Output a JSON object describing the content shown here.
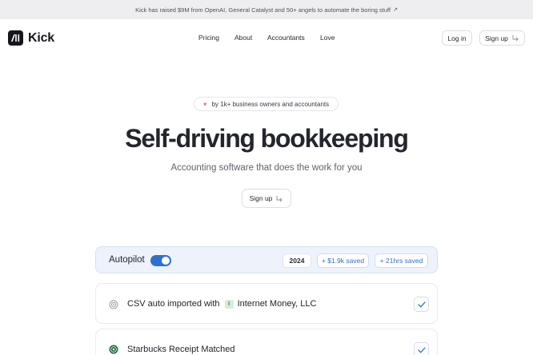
{
  "announcement": {
    "text": "Kick has raised $9M from OpenAI, General Catalyst and 50+ angels to automate the boring stuff",
    "arrow": "↗"
  },
  "brand": {
    "name": "Kick",
    "mark": "/ll"
  },
  "nav": {
    "links": [
      "Pricing",
      "About",
      "Accountants",
      "Love"
    ],
    "login": "Log in",
    "signup": "Sign up"
  },
  "hero": {
    "badge": "by 1k+ business owners and accountants",
    "title": "Self-driving bookkeeping",
    "subtitle": "Accounting software that does the work for you",
    "cta": "Sign up"
  },
  "autopilot": {
    "label": "Autopilot",
    "enabled": true,
    "year": "2024",
    "saved_money": "+ $1.9k saved",
    "saved_time": "+ 21hrs saved"
  },
  "feed": [
    {
      "prefix": "CSV auto imported with",
      "badge": "I",
      "entity": "Internet Money, LLC",
      "checked": true
    },
    {
      "text": "Starbucks Receipt Matched",
      "checked": true
    }
  ],
  "colors": {
    "accent": "#2f6fd1",
    "dark": "#16171c",
    "announce_bg": "#eeeef1",
    "autopilot_bg": "#eef3fb"
  }
}
